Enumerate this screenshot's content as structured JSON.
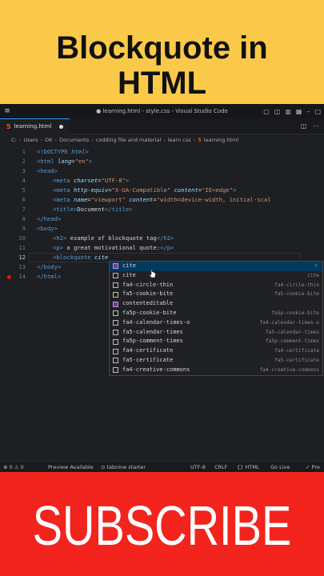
{
  "banner": {
    "line1": "Blockquote in",
    "line2": "HTML"
  },
  "window": {
    "title": "● learning.html - style.css - Visual Studio Code",
    "menu_icon": "hamburger-icon"
  },
  "tab": {
    "filename": "learning.html",
    "icon_text": "5"
  },
  "breadcrumb": [
    "C:",
    "Users",
    "OK",
    "Documents",
    "codding file and material",
    "learn css",
    "learning.html"
  ],
  "code": {
    "line_numbers": [
      "1",
      "2",
      "3",
      "4",
      "5",
      "6",
      "7",
      "8",
      "9",
      "10",
      "11",
      "12",
      "13",
      "14"
    ],
    "l1": {
      "a": "<!DOCTYPE ",
      "b": "html",
      "c": ">"
    },
    "l2": {
      "a": "<html ",
      "b": "lang",
      "c": "=",
      "d": "\"en\"",
      "e": ">"
    },
    "l3": {
      "a": "<head>"
    },
    "l4": {
      "a": "<meta ",
      "b": "charset",
      "c": "=",
      "d": "\"UTF-8\"",
      "e": ">"
    },
    "l5": {
      "a": "<meta ",
      "b": "http-equiv",
      "c": "=",
      "d": "\"X-UA-Compatible\"",
      "e": " content",
      "f": "=",
      "g": "\"IE=edge\"",
      "h": ">"
    },
    "l6": {
      "a": "<meta ",
      "b": "name",
      "c": "=",
      "d": "\"viewport\"",
      "e": " content",
      "f": "=",
      "g": "\"width=device-width, initial-scal"
    },
    "l7": {
      "a": "<title>",
      "b": "Document",
      "c": "</title>"
    },
    "l8": {
      "a": "</head>"
    },
    "l9": {
      "a": "<body>"
    },
    "l10": {
      "a": "<h2>",
      "b": " example of blockquote tag",
      "c": "</h2>"
    },
    "l11": {
      "a": "<p>",
      "b": " a great motivational quote:",
      "c": "</p>"
    },
    "l12": {
      "a": "<blockquote ",
      "b": "cite"
    },
    "l13": {
      "a": "</body>"
    },
    "l14": {
      "a": "</html>"
    }
  },
  "suggestions": [
    {
      "label": "cite",
      "detail": "",
      "selected": true
    },
    {
      "label": "cite",
      "detail": "cite"
    },
    {
      "label": "fa4-circle-thin",
      "detail": "fa4-circle-thin"
    },
    {
      "label": "fa5-cookie-bite",
      "detail": "fa5-cookie-bite"
    },
    {
      "label": "contenteditable",
      "detail": ""
    },
    {
      "label": "fa5p-cookie-bite",
      "detail": "fa5p-cookie-bite"
    },
    {
      "label": "fa4-calendar-times-o",
      "detail": "fa4-calendar-times-o"
    },
    {
      "label": "fa5-calendar-times",
      "detail": "fa5-calendar-times"
    },
    {
      "label": "fa5p-comment-times",
      "detail": "fa5p-comment-times"
    },
    {
      "label": "fa4-certificate",
      "detail": "fa4-certificate"
    },
    {
      "label": "fa5-certificate",
      "detail": "fa5-certificate"
    },
    {
      "label": "fa4-creative-commons",
      "detail": "fa4-creative-commons"
    }
  ],
  "statusbar": {
    "problems": "⊗ 0 ⚠ 0",
    "preview": "Preview Available",
    "tabnine": "⊙ tabnine starter",
    "encoding": "UTF-8",
    "eol": "CRLF",
    "language": "{} HTML",
    "golive": "Go Live",
    "prettier": "✓ Pre"
  },
  "subscribe": {
    "label": "SUBSCRIBE"
  },
  "colors": {
    "banner": "#fbc94a",
    "subscribe": "#f2241d",
    "editor_bg": "#1e1f22",
    "selection": "#04395e"
  }
}
